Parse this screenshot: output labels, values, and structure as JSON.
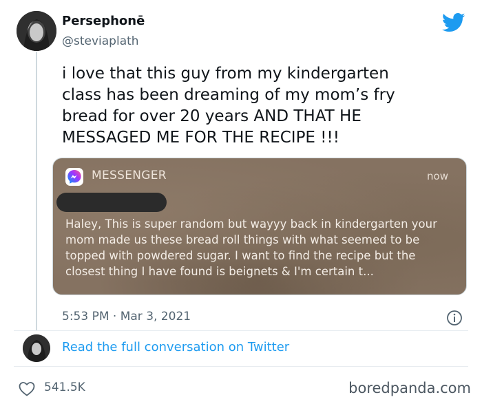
{
  "tweet": {
    "display_name": "Persephonē",
    "handle": "@steviaplath",
    "text": "i love that this guy from my kindergarten\nclass has been dreaming of my mom’s fry\nbread for over 20 years AND THAT HE\nMESSAGED ME FOR THE RECIPE !!!",
    "timestamp": "5:53 PM · Mar 3, 2021",
    "read_more": "Read the full conversation on Twitter",
    "likes": "541.5K"
  },
  "notification": {
    "app": "MESSENGER",
    "time": "now",
    "body": "Haley, This is super random but wayyy back in kindergarten your mom made us these bread roll things with what seemed to be topped with powdered sugar. I want to find the recipe but the closest thing I have found is beignets & I'm certain t..."
  },
  "watermark": "boredpanda.com",
  "colors": {
    "twitter_blue": "#1d9bf0",
    "secondary_text": "#536471",
    "notification_bg": "#857261"
  },
  "icons": [
    "twitter-bird-icon",
    "messenger-icon",
    "info-icon",
    "heart-icon"
  ]
}
